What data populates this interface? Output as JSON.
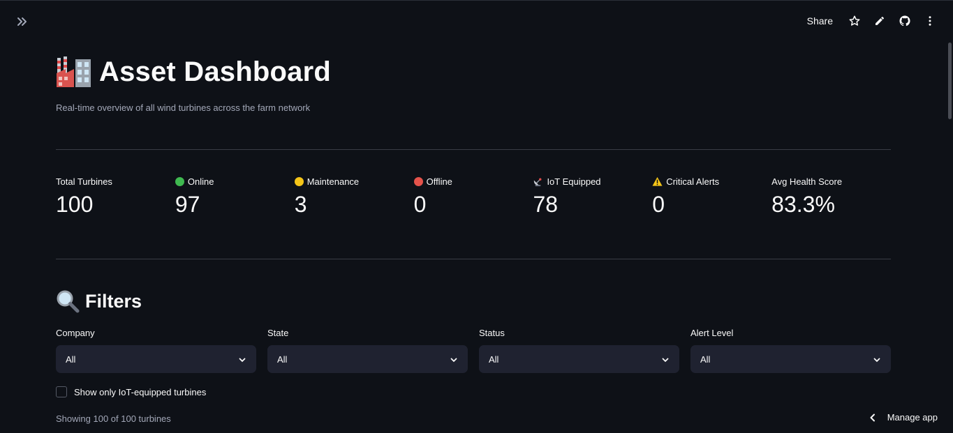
{
  "header": {
    "share_label": "Share",
    "icons": [
      "expand-sidebar-icon",
      "star-icon",
      "edit-pencil-icon",
      "github-icon",
      "more-vertical-icon"
    ]
  },
  "page": {
    "title": "Asset Dashboard",
    "title_icon": "factory-emoji-icon",
    "subtitle": "Real-time overview of all wind turbines across the farm network"
  },
  "metrics": [
    {
      "label": "Total Turbines",
      "value": "100",
      "icon": ""
    },
    {
      "label": "Online",
      "value": "97",
      "icon": "green-circle-icon"
    },
    {
      "label": "Maintenance",
      "value": "3",
      "icon": "yellow-circle-icon"
    },
    {
      "label": "Offline",
      "value": "0",
      "icon": "red-circle-icon"
    },
    {
      "label": "IoT Equipped",
      "value": "78",
      "icon": "satellite-antenna-icon"
    },
    {
      "label": "Critical Alerts",
      "value": "0",
      "icon": "warning-icon"
    },
    {
      "label": "Avg Health Score",
      "value": "83.3%",
      "icon": ""
    }
  ],
  "filters": {
    "heading": "Filters",
    "heading_icon": "magnifying-glass-icon",
    "selects": [
      {
        "label": "Company",
        "value": "All"
      },
      {
        "label": "State",
        "value": "All"
      },
      {
        "label": "Status",
        "value": "All"
      },
      {
        "label": "Alert Level",
        "value": "All"
      }
    ],
    "iot_only_label": "Show only IoT-equipped turbines",
    "iot_only_checked": false
  },
  "showing_text": "Showing 100 of 100 turbines",
  "manage_app_label": "Manage app",
  "colors": {
    "background": "#0e1117",
    "select_bg": "#1f2230",
    "text": "#fafafa",
    "muted": "#a3a8b8",
    "online": "#3fb950",
    "maintenance": "#f5c518",
    "offline": "#e5534b"
  }
}
